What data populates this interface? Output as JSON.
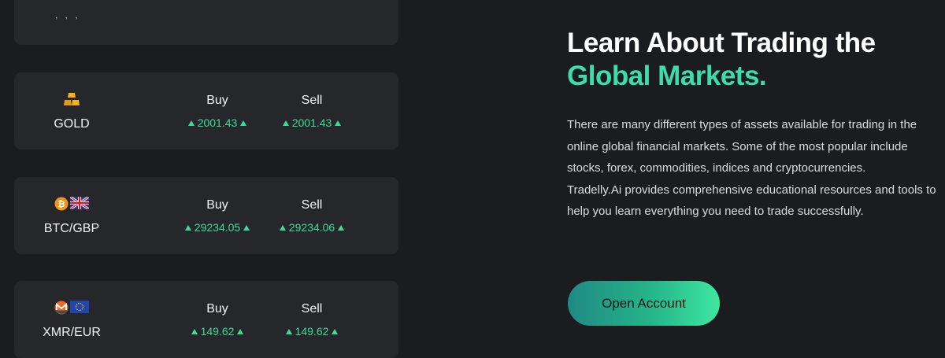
{
  "partial_card": {
    "text": ", , ,"
  },
  "instruments": [
    {
      "symbol": "GOLD",
      "icons": [
        "gold-bars-icon"
      ],
      "buy_label": "Buy",
      "sell_label": "Sell",
      "buy": "2001.43",
      "sell": "2001.43"
    },
    {
      "symbol": "BTC/GBP",
      "icons": [
        "bitcoin-icon",
        "uk-flag-icon"
      ],
      "buy_label": "Buy",
      "sell_label": "Sell",
      "buy": "29234.05",
      "sell": "29234.06"
    },
    {
      "symbol": "XMR/EUR",
      "icons": [
        "monero-icon",
        "eu-flag-icon"
      ],
      "buy_label": "Buy",
      "sell_label": "Sell",
      "buy": "149.62",
      "sell": "149.62"
    }
  ],
  "promo": {
    "headline_line1": "Learn About Trading the",
    "headline_line2": "Global Markets.",
    "paragraph1": "There are many different types of assets available for trading in the online global financial markets. Some of the most popular include stocks, forex, commodities, indices and cryptocurrencies.",
    "paragraph2": "Tradelly.Ai provides comprehensive educational resources and tools to help you learn everything you need to trade successfully.",
    "cta_label": "Open Account"
  },
  "colors": {
    "background": "#1b1c1f",
    "card": "#25272b",
    "accent_green": "#3ddc97",
    "headline_accent": "#3ddcab",
    "gold": "#f2b21b",
    "bitcoin": "#f7931a",
    "monero": "#f26822"
  }
}
